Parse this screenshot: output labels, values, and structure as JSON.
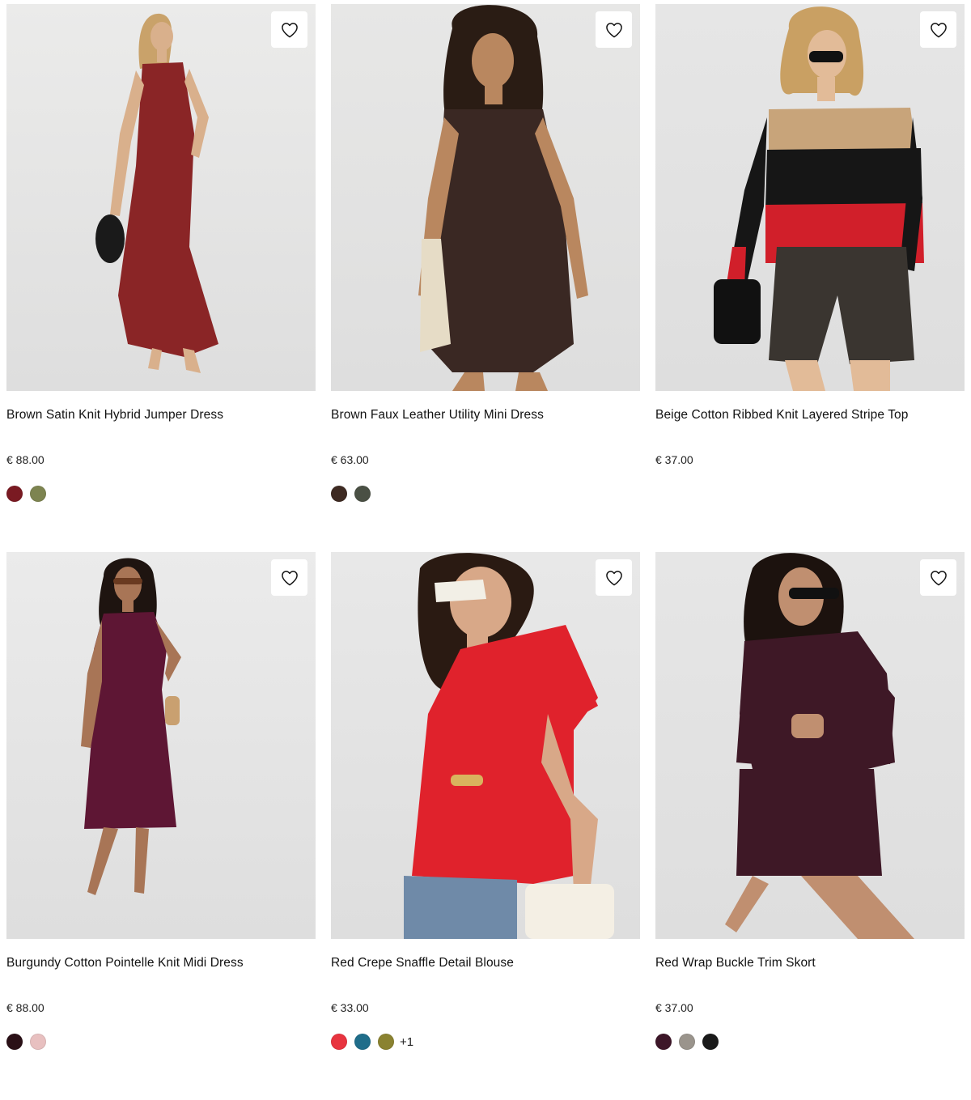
{
  "products": [
    {
      "title": "Brown Satin Knit Hybrid Jumper Dress",
      "price": "€ 88.00",
      "swatches": [
        "#7a1a22",
        "#7d8450"
      ],
      "more": "",
      "bg": "#ebebea",
      "garment": "#8a2526",
      "accent": "#1a1a1a",
      "hair": "#c9a26a",
      "skin": "#d9b08c"
    },
    {
      "title": "Brown Faux Leather Utility Mini Dress",
      "price": "€ 63.00",
      "swatches": [
        "#3e2a22",
        "#4a5044"
      ],
      "more": "",
      "bg": "#e7e7e6",
      "garment": "#3a2823",
      "accent": "#e6dcc6",
      "hair": "#2a1c14",
      "skin": "#b9875f"
    },
    {
      "title": "Beige Cotton Ribbed Knit Layered Stripe Top",
      "price": "€ 37.00",
      "swatches": [],
      "more": "",
      "bg": "#e6e6e6",
      "garment": "#161616",
      "accent": "#d11f2a",
      "hair": "#c9a063",
      "skin": "#e2bb98"
    },
    {
      "title": "Burgundy Cotton Pointelle Knit Midi Dress",
      "price": "€ 88.00",
      "swatches": [
        "#2a1016",
        "#e8c0c0"
      ],
      "more": "",
      "bg": "#ebebeb",
      "garment": "#5e1634",
      "accent": "#c9a070",
      "hair": "#1e1410",
      "skin": "#a87556"
    },
    {
      "title": "Red Crepe Snaffle Detail Blouse",
      "price": "€ 33.00",
      "swatches": [
        "#e8343f",
        "#1f6d8a",
        "#8a8230"
      ],
      "more": "+1",
      "bg": "#e8e8e8",
      "garment": "#e0222c",
      "accent": "#6f8aa8",
      "hair": "#2a1a12",
      "skin": "#d8a888"
    },
    {
      "title": "Red Wrap Buckle Trim Skort",
      "price": "€ 37.00",
      "swatches": [
        "#3d1628",
        "#9a948c",
        "#1a1a1a"
      ],
      "more": "",
      "bg": "#e6e6e6",
      "garment": "#3e1826",
      "accent": "#121212",
      "hair": "#1c120e",
      "skin": "#c08f70"
    }
  ],
  "icons": {
    "wishlist": "heart-outline-icon"
  }
}
